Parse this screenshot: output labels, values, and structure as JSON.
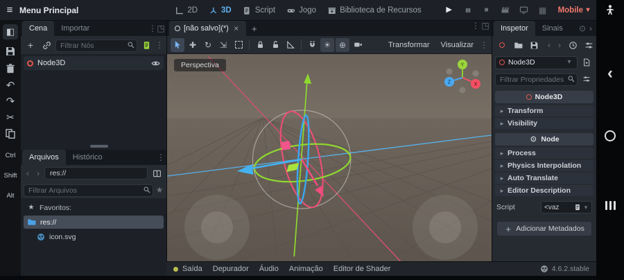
{
  "icons": {
    "hamburger": "≡",
    "dots": "⋮",
    "caret_down": "▾",
    "caret_right": "▸",
    "chevron_left": "‹",
    "chevron_right": "›",
    "close": "×",
    "plus": "+",
    "star": "★",
    "play": "▶",
    "pause": "▮▮",
    "stop": "■",
    "grid": "▦",
    "expand": "◳",
    "panel": "◧",
    "undo": "↶",
    "redo": "↷",
    "cut": "✂",
    "sun": "☀",
    "globe": "⊕",
    "node_circle": "⊙",
    "move": "✚",
    "rotate": "↻",
    "scale": "⇲"
  },
  "colors": {
    "accent_blue": "#5fb0f0",
    "renderer_red": "#f0786c",
    "axis_x": "#ea4f74",
    "axis_y": "#8fd92f",
    "axis_z": "#45a8f0",
    "selection_row": "#454d59"
  },
  "menubar": {
    "main_menu": "Menu Principal",
    "workspaces": [
      {
        "label": "2D"
      },
      {
        "label": "3D"
      },
      {
        "label": "Script"
      },
      {
        "label": "Jogo"
      },
      {
        "label": "Biblioteca de Recursos"
      }
    ],
    "renderer": "Mobile"
  },
  "android": {
    "modifier_keys": [
      {
        "label": "Ctrl"
      },
      {
        "label": "Shift"
      },
      {
        "label": "Alt"
      }
    ]
  },
  "scene_dock": {
    "tabs": [
      {
        "label": "Cena"
      },
      {
        "label": "Importar"
      }
    ],
    "filter_placeholder": "Filtrar Nós",
    "root_node": "Node3D"
  },
  "filesystem_dock": {
    "tabs": [
      {
        "label": "Arquivos"
      },
      {
        "label": "Histórico"
      }
    ],
    "path": "res://",
    "filter_placeholder": "Filtrar Arquivos",
    "favorites_label": "Favoritos:",
    "items": [
      {
        "label": "res://"
      },
      {
        "label": "icon.svg"
      }
    ]
  },
  "viewport": {
    "scene_tab": "[não salvo](*)",
    "perspective": "Perspectiva",
    "menus": [
      {
        "label": "Transformar"
      },
      {
        "label": "Visualizar"
      }
    ],
    "axis_labels": {
      "x": "X",
      "y": "Y",
      "z": "Z"
    }
  },
  "bottom_bar": {
    "panels": [
      {
        "label": "Saída"
      },
      {
        "label": "Depurador"
      },
      {
        "label": "Áudio"
      },
      {
        "label": "Animação"
      },
      {
        "label": "Editor de Shader"
      }
    ],
    "version": "4.6.2.stable"
  },
  "inspector": {
    "tabs": [
      {
        "label": "Inspetor"
      },
      {
        "label": "Sinais"
      }
    ],
    "node_selector": "Node3D",
    "filter_placeholder": "Filtrar Propriedades",
    "category_node3d": "Node3D",
    "sections_node3d": [
      {
        "label": "Transform"
      },
      {
        "label": "Visibility"
      }
    ],
    "category_node": "Node",
    "sections_node": [
      {
        "label": "Process"
      },
      {
        "label": "Physics Interpolation"
      },
      {
        "label": "Auto Translate"
      },
      {
        "label": "Editor Description"
      }
    ],
    "script_label": "Script",
    "script_value": "<vaz",
    "add_metadata_label": "Adicionar Metadados"
  }
}
